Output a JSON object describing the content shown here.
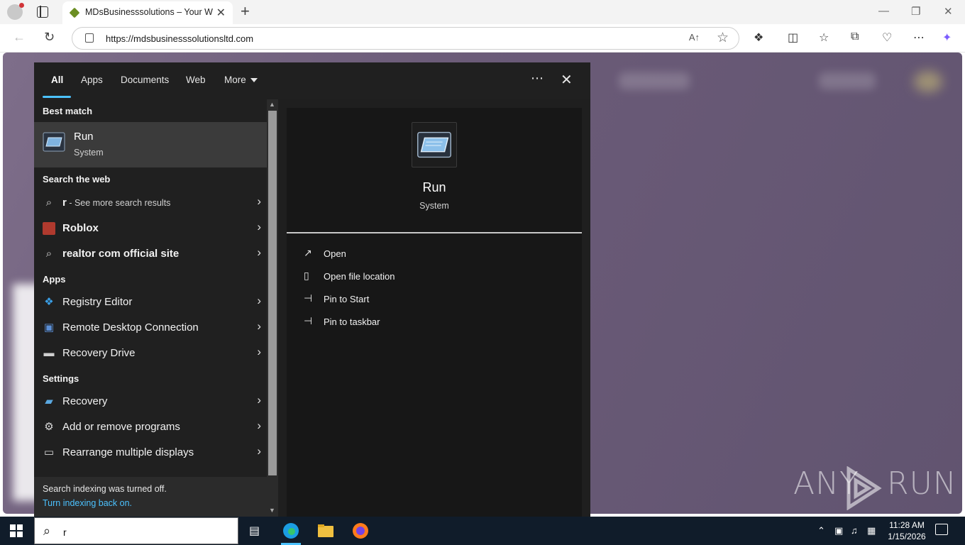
{
  "browser": {
    "tab_title": "MDsBusinesssolutions – Your Wo",
    "url": "https://mdsbusinesssolutionsltd.com",
    "read_aloud_label": "A↑",
    "tab_close": "✕",
    "new_tab": "+"
  },
  "search_panel": {
    "filters": [
      "All",
      "Apps",
      "Documents",
      "Web",
      "More"
    ],
    "active_filter": "All",
    "best_match": {
      "heading": "Best match",
      "name": "Run",
      "subtitle": "System"
    },
    "web": {
      "heading": "Search the web",
      "items": [
        {
          "query": "r",
          "suffix": " - See more search results",
          "icon": "search-icon"
        },
        {
          "query": "Roblox",
          "suffix": "",
          "icon": "roblox-icon"
        },
        {
          "query": "realtor com official site",
          "suffix": "",
          "icon": "search-icon"
        }
      ]
    },
    "apps": {
      "heading": "Apps",
      "items": [
        {
          "label": "Registry Editor",
          "icon": "registry-editor-icon"
        },
        {
          "label": "Remote Desktop Connection",
          "icon": "remote-desktop-icon"
        },
        {
          "label": "Recovery Drive",
          "icon": "recovery-drive-icon"
        }
      ]
    },
    "settings": {
      "heading": "Settings",
      "items": [
        {
          "label": "Recovery",
          "icon": "recovery-icon"
        },
        {
          "label": "Add or remove programs",
          "icon": "gear-icon"
        },
        {
          "label": "Rearrange multiple displays",
          "icon": "display-icon"
        }
      ]
    },
    "indexing": {
      "message": "Search indexing was turned off.",
      "link": "Turn indexing back on."
    },
    "preview": {
      "name": "Run",
      "subtitle": "System",
      "actions": [
        {
          "label": "Open",
          "icon": "open-icon"
        },
        {
          "label": "Open file location",
          "icon": "file-location-icon"
        },
        {
          "label": "Pin to Start",
          "icon": "pin-icon"
        },
        {
          "label": "Pin to taskbar",
          "icon": "pin-icon"
        }
      ]
    }
  },
  "taskbar": {
    "search_value": "r",
    "time": "11:28 AM",
    "date": "1/15/2026"
  },
  "watermark": {
    "left": "ANY",
    "right": "RUN"
  },
  "colors": {
    "accent": "#4cc2ff",
    "panel_bg": "#202020",
    "taskbar_bg": "#101c2a",
    "page_bg": "#6b5b78"
  }
}
